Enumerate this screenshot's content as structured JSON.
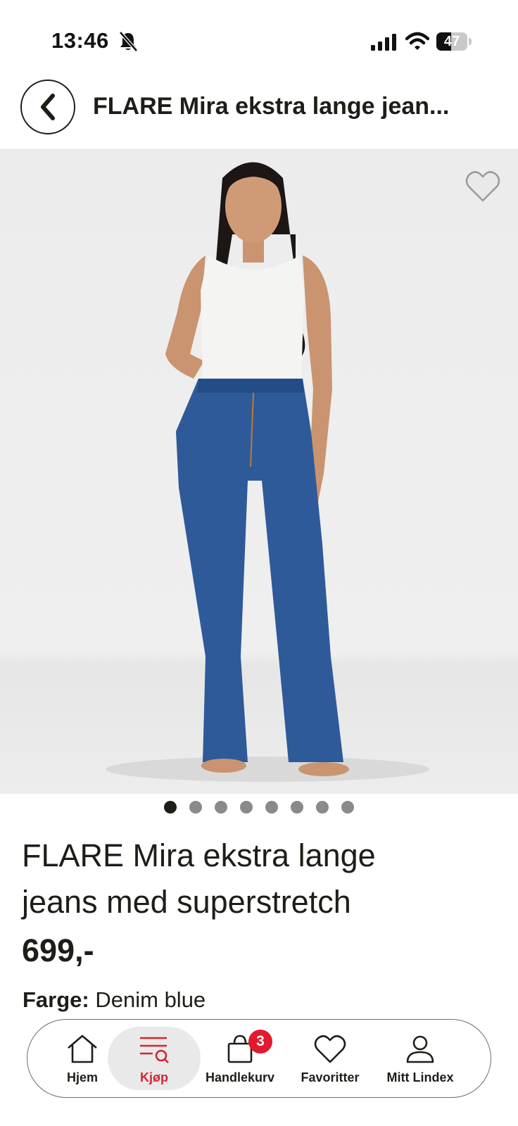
{
  "status_bar": {
    "time": "13:46",
    "battery": "47",
    "battery_level": 0.47
  },
  "header": {
    "title": "FLARE Mira ekstra lange jean..."
  },
  "carousel": {
    "total": 8,
    "active_index": 0
  },
  "product": {
    "name": "FLARE Mira ekstra lange jeans med superstretch",
    "price": "699,-",
    "color_label": "Farge:",
    "color_value": "Denim blue"
  },
  "tab_bar": {
    "items": [
      {
        "label": "Hjem",
        "icon": "home-icon"
      },
      {
        "label": "Kjøp",
        "icon": "shop-search-icon",
        "active": true
      },
      {
        "label": "Handlekurv",
        "icon": "shopping-bag-icon",
        "badge": "3"
      },
      {
        "label": "Favoritter",
        "icon": "heart-icon"
      },
      {
        "label": "Mitt Lindex",
        "icon": "user-icon"
      }
    ]
  },
  "colors": {
    "text": "#1f1d18",
    "accent_red": "#d12632",
    "badge_red": "#e3192e",
    "denim": "#2e5a99"
  }
}
